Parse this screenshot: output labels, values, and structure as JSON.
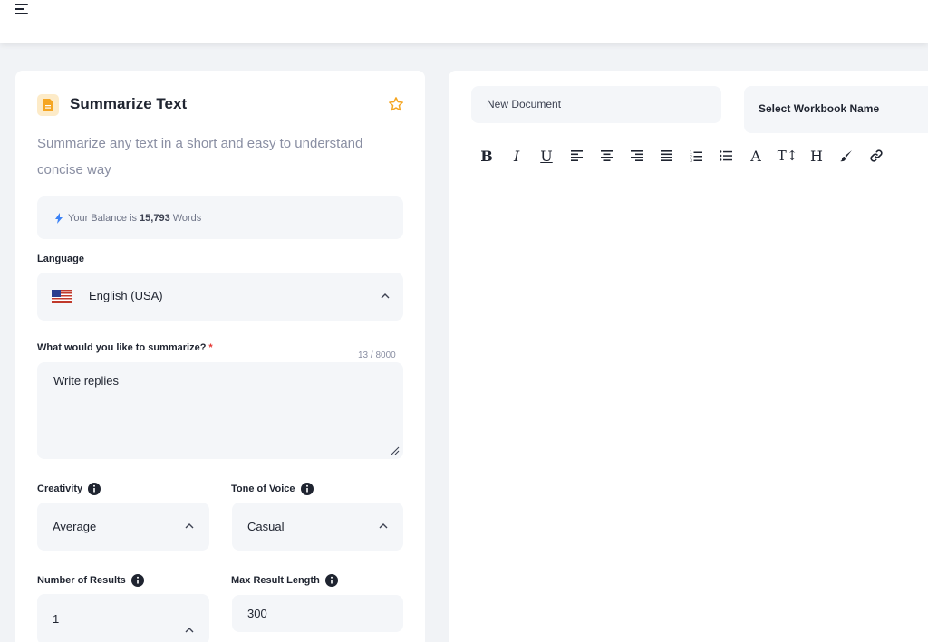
{
  "header": {
    "menu_icon": "menu-icon"
  },
  "tool": {
    "title": "Summarize Text",
    "description": "Summarize any text in a short and easy to understand concise way",
    "icon": "document-icon",
    "favorite_icon": "star-icon",
    "accent_color": "#f5a623"
  },
  "balance": {
    "prefix": "Your Balance is",
    "amount": "15,793",
    "suffix": "Words"
  },
  "language": {
    "label": "Language",
    "value": "English (USA)"
  },
  "summarize": {
    "label": "What would you like to summarize?",
    "required_mark": "*",
    "counter": "13 / 8000",
    "value": "Write replies"
  },
  "creativity": {
    "label": "Creativity",
    "value": "Average"
  },
  "tone": {
    "label": "Tone of Voice",
    "value": "Casual"
  },
  "results": {
    "label": "Number of Results",
    "value": "1"
  },
  "max_length": {
    "label": "Max Result Length",
    "value": "300"
  },
  "editor": {
    "document_name": "New Document",
    "workbook_placeholder": "Select Workbook Name",
    "toolbar": {
      "bold": "B",
      "italic": "I",
      "underline": "U",
      "font_color": "A",
      "text_size": "T↕",
      "heading": "H"
    }
  }
}
